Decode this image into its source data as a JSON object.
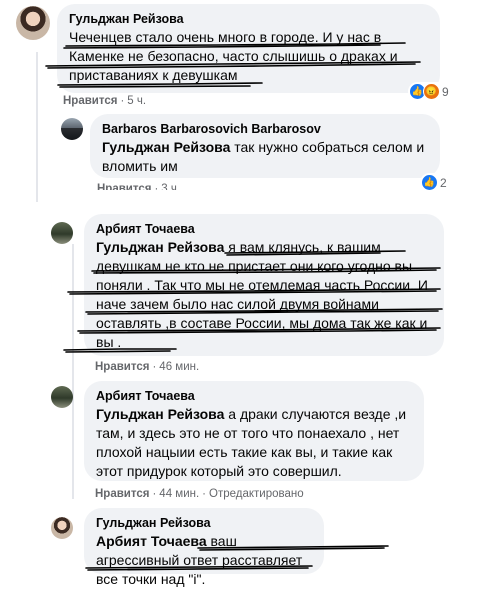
{
  "comments": [
    {
      "author": "Гульджан Рейзова",
      "mention": "",
      "text": "Чеченцев стало очень много в городе. И у нас в Каменке не безопасно, часто слышишь о драках и приставаниях к девушкам",
      "like": "Нравится",
      "time": "5 ч.",
      "reactions": "9"
    },
    {
      "author": "Barbaros Barbarosovich Barbarosov",
      "mention": "Гульджан Рейзова",
      "text": "так нужно собраться селом и вломить им",
      "like": "Нравится",
      "time": "3 ч.",
      "reactions": "2"
    },
    {
      "author": "Арбият Точаева",
      "mention": "Гульджан Рейзова",
      "text": "я вам клянусь, к вашим девушкам не кто не пристает они кого угодно вы поняли . Так что мы не отемлемая часть России. И наче зачем было нас силой двумя войнами оставлять ,в составе России, мы дома так же как и вы .",
      "like": "Нравится",
      "time": "46 мин."
    },
    {
      "author": "Арбият Точаева",
      "mention": "Гульджан Рейзова",
      "text": "а драки случаются везде ,и там, и здесь это не от того что понаехало , нет плохой нацыии есть такие как вы, и такие как этот придурок который это совершил.",
      "like": "Нравится",
      "time": "44 мин.",
      "edited": "Отредактировано"
    },
    {
      "author": "Гульджан Рейзова",
      "mention": "Арбият Точаева",
      "text": "ваш агрессивный ответ расставляет все точки над \"i\"."
    }
  ],
  "icons": {
    "like": "like-icon",
    "angry": "angry-icon"
  },
  "colors": {
    "bubble": "#f0f2f5",
    "meta": "#65676b",
    "like": "#1877f2",
    "angry": "#e9710f",
    "ink": "#000000"
  }
}
